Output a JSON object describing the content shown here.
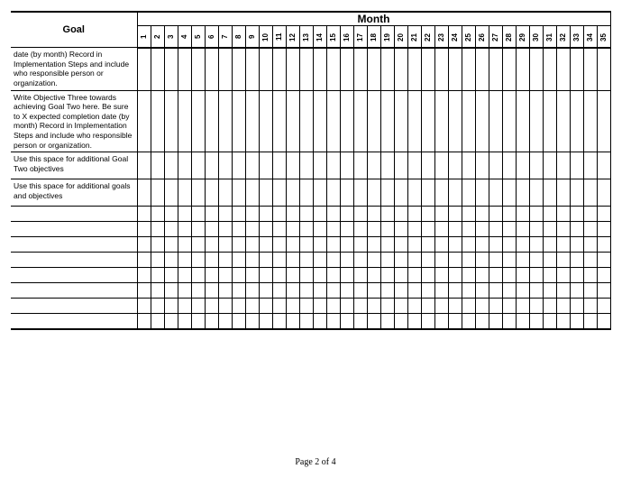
{
  "header": {
    "goal_label": "Goal",
    "month_label": "Month",
    "months": [
      "1",
      "2",
      "3",
      "4",
      "5",
      "6",
      "7",
      "8",
      "9",
      "10",
      "11",
      "12",
      "13",
      "14",
      "15",
      "16",
      "17",
      "18",
      "19",
      "20",
      "21",
      "22",
      "23",
      "24",
      "25",
      "26",
      "27",
      "28",
      "29",
      "30",
      "31",
      "32",
      "33",
      "34",
      "35"
    ]
  },
  "rows": [
    {
      "text": "date (by month) Record in Implementation Steps and include who responsible person or organization."
    },
    {
      "text": "Write Objective Three towards achieving Goal Two here. Be sure to X expected completion date (by month) Record in Implementation Steps and include who responsible person or organization."
    },
    {
      "text": "Use this space for additional Goal Two objectives",
      "tall": true
    },
    {
      "text": "Use this space for additional goals and objectives",
      "tall": true
    },
    {
      "text": ""
    },
    {
      "text": ""
    },
    {
      "text": ""
    },
    {
      "text": ""
    },
    {
      "text": ""
    },
    {
      "text": ""
    },
    {
      "text": ""
    },
    {
      "text": ""
    }
  ],
  "footer": {
    "page_text": "Page 2 of 4"
  }
}
